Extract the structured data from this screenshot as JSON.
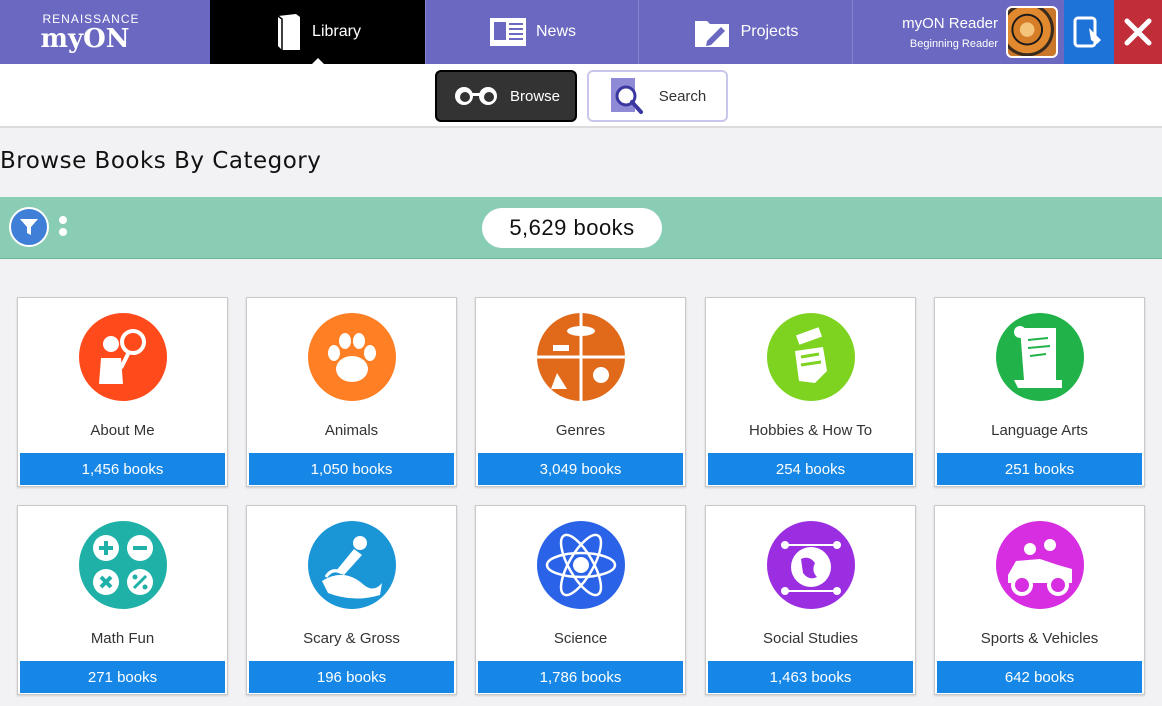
{
  "brand": {
    "small": "RENAISSANCE",
    "big": "myON"
  },
  "nav": {
    "library": "Library",
    "news": "News",
    "projects": "Projects"
  },
  "user": {
    "name": "myON Reader",
    "level": "Beginning Reader"
  },
  "toolbar": {
    "browse": "Browse",
    "search": "Search"
  },
  "page": {
    "title": "Browse Books By Category",
    "total_books": "5,629 books"
  },
  "categories": [
    {
      "label": "About Me",
      "count": "1,456 books",
      "color": "#ff4a1c",
      "icon": "person-magnifier-icon"
    },
    {
      "label": "Animals",
      "count": "1,050 books",
      "color": "#ff7f24",
      "icon": "paw-icon"
    },
    {
      "label": "Genres",
      "count": "3,049 books",
      "color": "#e06a1a",
      "icon": "genres-icon"
    },
    {
      "label": "Hobbies & How To",
      "count": "254 books",
      "color": "#7ed321",
      "icon": "hammer-fist-icon"
    },
    {
      "label": "Language Arts",
      "count": "251 books",
      "color": "#21b34a",
      "icon": "scroll-icon"
    },
    {
      "label": "Math Fun",
      "count": "271 books",
      "color": "#1fb1a8",
      "icon": "math-symbols-icon"
    },
    {
      "label": "Scary & Gross",
      "count": "196 books",
      "color": "#1a96d6",
      "icon": "slime-icon"
    },
    {
      "label": "Science",
      "count": "1,786 books",
      "color": "#2a63e8",
      "icon": "atom-icon"
    },
    {
      "label": "Social Studies",
      "count": "1,463 books",
      "color": "#9b2ee0",
      "icon": "globe-icon"
    },
    {
      "label": "Sports & Vehicles",
      "count": "642 books",
      "color": "#d62ee0",
      "icon": "car-icon"
    }
  ]
}
